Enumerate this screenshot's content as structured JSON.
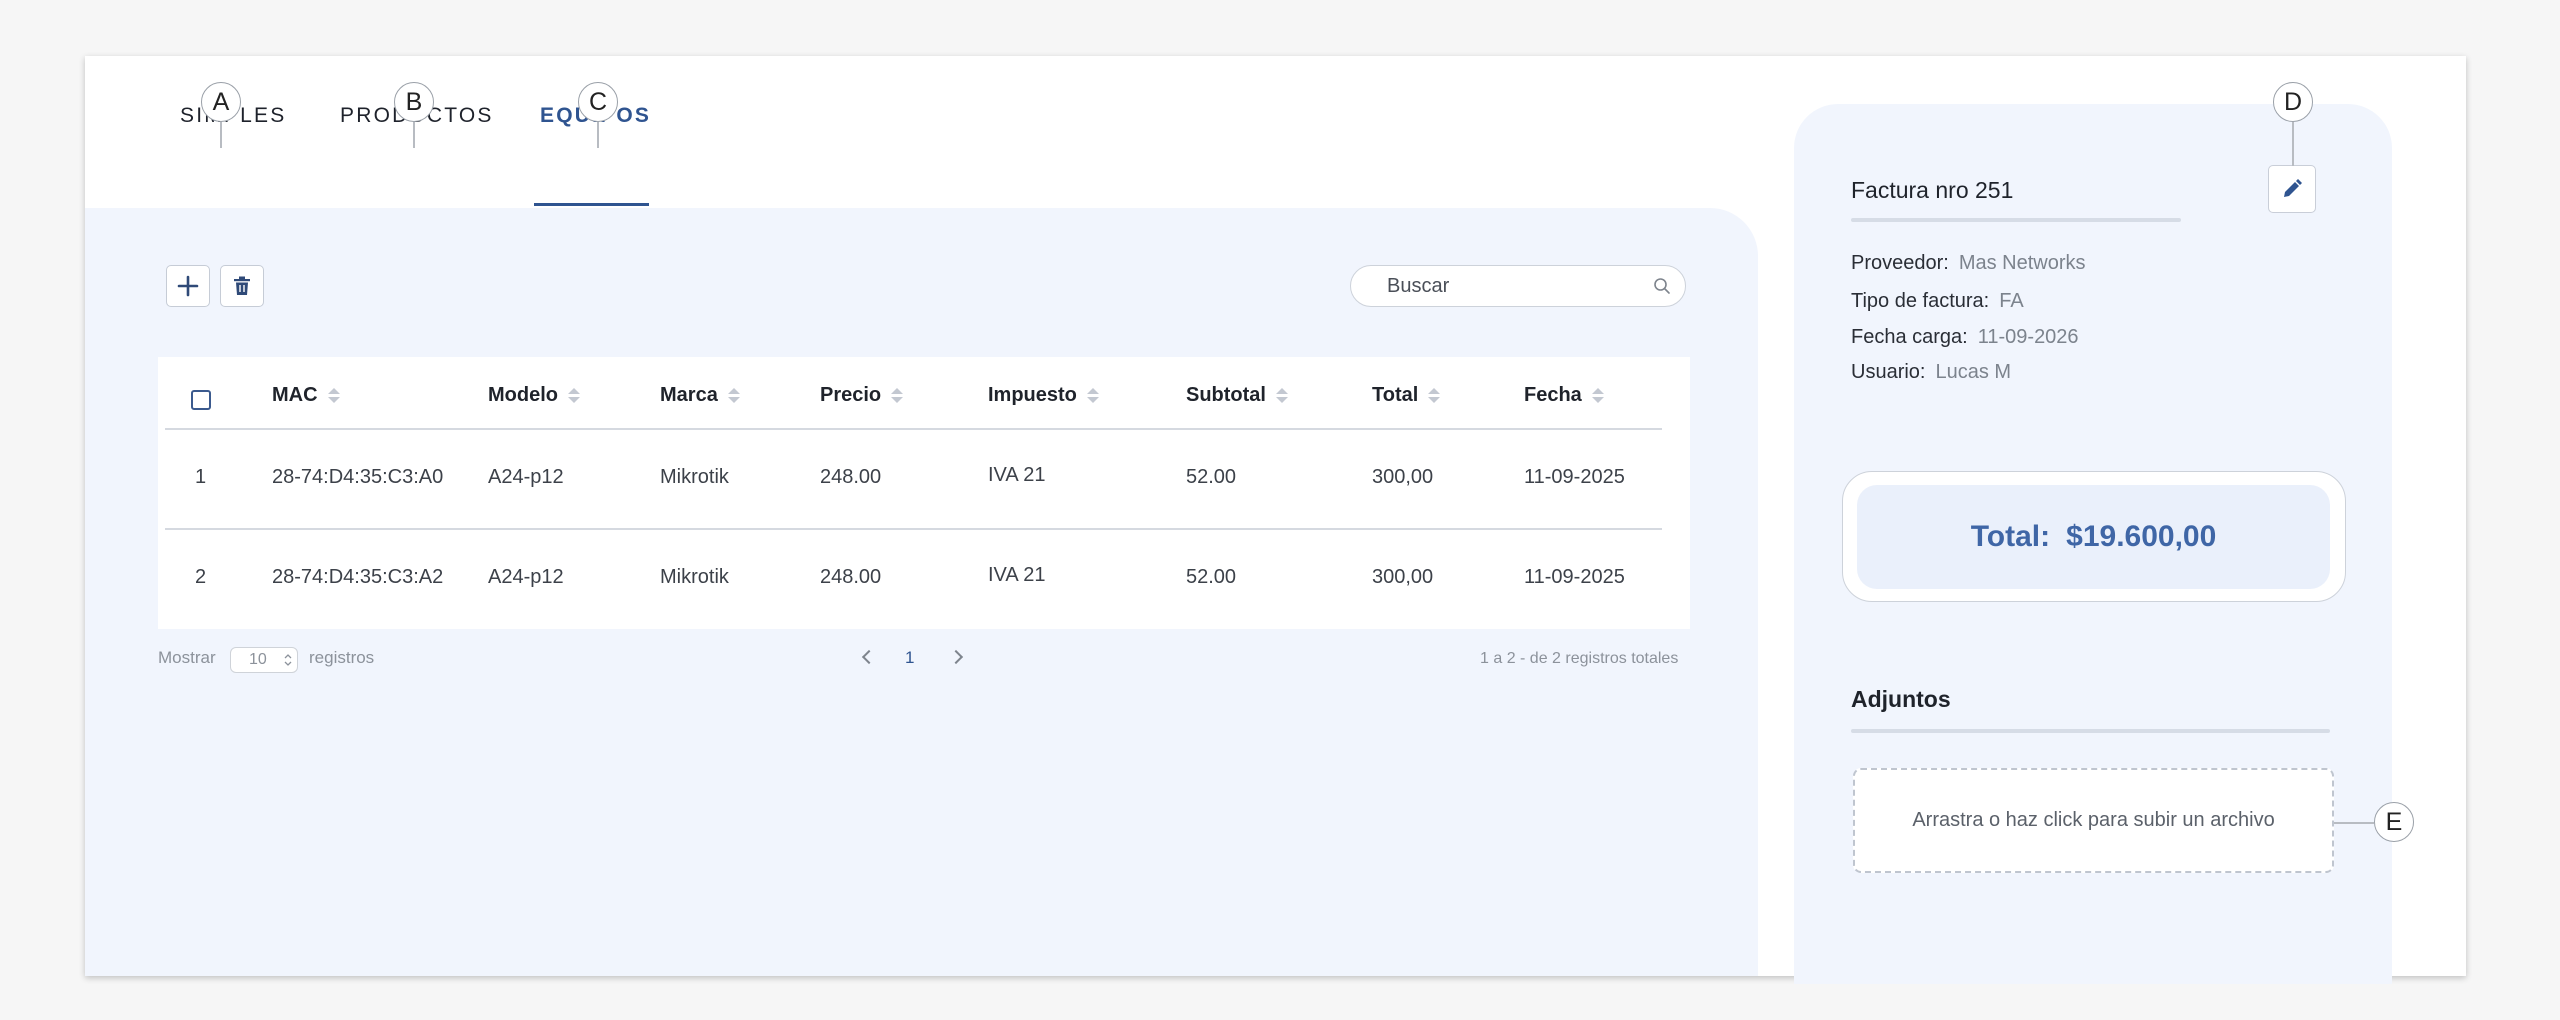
{
  "tabs": [
    {
      "label": "SIMPLES",
      "callout": "A",
      "active": false
    },
    {
      "label": "PRODUCTOS",
      "callout": "B",
      "active": false
    },
    {
      "label": "EQUIPOS",
      "callout": "C",
      "active": true
    }
  ],
  "toolbar": {
    "add_icon": "plus-icon",
    "delete_icon": "trash-icon",
    "search_placeholder": "Buscar",
    "search_icon": "search-icon"
  },
  "table": {
    "columns": [
      "MAC",
      "Modelo",
      "Marca",
      "Precio",
      "Impuesto",
      "Subtotal",
      "Total",
      "Fecha"
    ],
    "rows": [
      {
        "n": "1",
        "mac": "28-74:D4:35:C3:A0",
        "modelo": "A24-p12",
        "marca": "Mikrotik",
        "precio": "248.00",
        "impuesto": "IVA 21",
        "subtotal": "52.00",
        "total": "300,00",
        "fecha": "11-09-2025"
      },
      {
        "n": "2",
        "mac": "28-74:D4:35:C3:A2",
        "modelo": "A24-p12",
        "marca": "Mikrotik",
        "precio": "248.00",
        "impuesto": "IVA 21",
        "subtotal": "52.00",
        "total": "300,00",
        "fecha": "11-09-2025"
      }
    ]
  },
  "pagination": {
    "show_label": "Mostrar",
    "page_size": "10",
    "records_label": "registros",
    "current_page": "1",
    "summary": "1 a 2 - de 2 registros totales"
  },
  "invoice": {
    "title": "Factura nro 251",
    "edit_callout": "D",
    "fields": [
      {
        "label": "Proveedor:",
        "value": "Mas Networks"
      },
      {
        "label": "Tipo de factura:",
        "value": "FA"
      },
      {
        "label": "Fecha carga:",
        "value": "11-09-2026"
      },
      {
        "label": "Usuario:",
        "value": "Lucas M"
      }
    ],
    "total_label": "Total:",
    "total_value": "$19.600,00"
  },
  "attachments": {
    "title": "Adjuntos",
    "dropzone_text": "Arrastra o haz click para subir un archivo",
    "callout": "E"
  },
  "colors": {
    "accent": "#2f5490",
    "panel_bg": "#f1f5fd",
    "total_text": "#3f66a6"
  }
}
